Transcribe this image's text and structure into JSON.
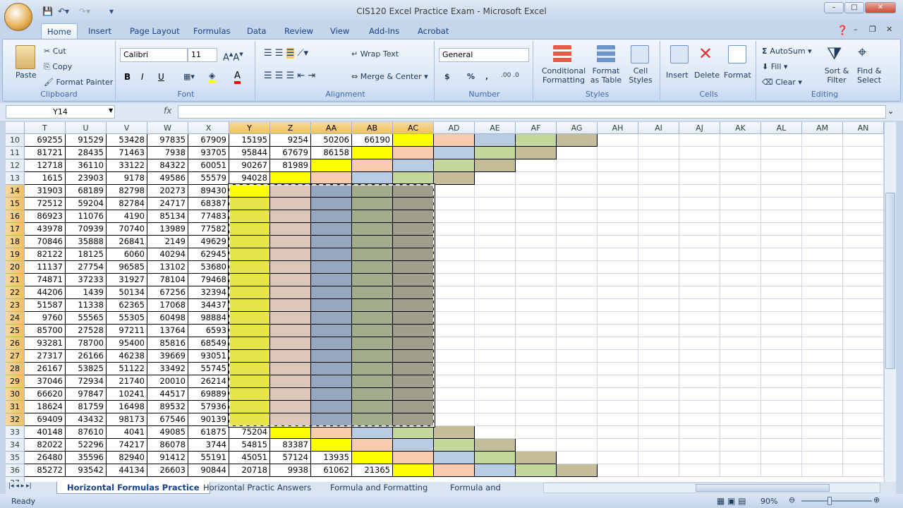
{
  "window": {
    "title": "CIS120 Excel Practice Exam - Microsoft Excel"
  },
  "ribbon_tabs": [
    "Home",
    "Insert",
    "Page Layout",
    "Formulas",
    "Data",
    "Review",
    "View",
    "Add-Ins",
    "Acrobat"
  ],
  "clipboard": {
    "paste": "Paste",
    "cut": "Cut",
    "copy": "Copy",
    "format_painter": "Format Painter",
    "label": "Clipboard"
  },
  "font": {
    "name": "Calibri",
    "size": "11",
    "bold": "B",
    "italic": "I",
    "underline": "U",
    "label": "Font"
  },
  "alignment": {
    "wrap": "Wrap Text",
    "merge": "Merge & Center",
    "label": "Alignment"
  },
  "number": {
    "format": "General",
    "currency": "$",
    "percent": "%",
    "comma": ",",
    "label": "Number"
  },
  "styles": {
    "conditional": "Conditional Formatting",
    "table": "Format as Table",
    "cell": "Cell Styles",
    "label": "Styles"
  },
  "cells": {
    "insert": "Insert",
    "delete": "Delete",
    "format": "Format",
    "label": "Cells"
  },
  "editing": {
    "autosum": "AutoSum",
    "fill": "Fill",
    "clear": "Clear",
    "sort": "Sort & Filter",
    "find": "Find & Select",
    "label": "Editing"
  },
  "formula_bar": {
    "name_box": "Y14",
    "fx": "fx",
    "value": ""
  },
  "columns": [
    "T",
    "U",
    "V",
    "W",
    "X",
    "Y",
    "Z",
    "AA",
    "AB",
    "AC",
    "AD",
    "AE",
    "AF",
    "AG",
    "AH",
    "AI",
    "AJ",
    "AK",
    "AL",
    "AM",
    "AN"
  ],
  "selected_columns": [
    "Y",
    "Z",
    "AA",
    "AB",
    "AC"
  ],
  "fill_colors": [
    "#ffff00",
    "#f8cbad",
    "#b8cce4",
    "#c4d79b",
    "#c4bd97"
  ],
  "selected_fill_colors": [
    "#e6e64a",
    "#dcc6b8",
    "#97a7c0",
    "#a1ad8c",
    "#a09d8c"
  ],
  "rows": [
    {
      "n": 10,
      "vals": [
        69255,
        91529,
        53428,
        97835,
        67909,
        15195,
        9254,
        50206,
        66190
      ],
      "fill": "AC"
    },
    {
      "n": 11,
      "vals": [
        81721,
        28435,
        71463,
        7938,
        93705,
        95844,
        67679,
        86158
      ],
      "fill": "AB"
    },
    {
      "n": 12,
      "vals": [
        12718,
        36110,
        33122,
        84322,
        60051,
        90267,
        81989
      ],
      "fill": "AA"
    },
    {
      "n": 13,
      "vals": [
        1615,
        23903,
        9178,
        49586,
        55579,
        94028
      ],
      "fill": "Z"
    },
    {
      "n": 14,
      "vals": [
        31903,
        68189,
        82798,
        20273,
        89430
      ],
      "fill": "Y",
      "sel": true
    },
    {
      "n": 15,
      "vals": [
        72512,
        59204,
        82784,
        24717,
        68387
      ],
      "fill": "Y",
      "sel": true
    },
    {
      "n": 16,
      "vals": [
        86923,
        11076,
        4190,
        85134,
        77483
      ],
      "fill": "Y",
      "sel": true
    },
    {
      "n": 17,
      "vals": [
        43978,
        70939,
        70740,
        13989,
        77582
      ],
      "fill": "Y",
      "sel": true
    },
    {
      "n": 18,
      "vals": [
        70846,
        35888,
        26841,
        2149,
        49629
      ],
      "fill": "Y",
      "sel": true
    },
    {
      "n": 19,
      "vals": [
        82122,
        18125,
        6060,
        40294,
        62945
      ],
      "fill": "Y",
      "sel": true
    },
    {
      "n": 20,
      "vals": [
        11137,
        27754,
        96585,
        13102,
        53680
      ],
      "fill": "Y",
      "sel": true
    },
    {
      "n": 21,
      "vals": [
        74871,
        37233,
        31927,
        78104,
        79468
      ],
      "fill": "Y",
      "sel": true
    },
    {
      "n": 22,
      "vals": [
        44206,
        1439,
        50134,
        67256,
        32394
      ],
      "fill": "Y",
      "sel": true
    },
    {
      "n": 23,
      "vals": [
        51587,
        11338,
        62365,
        17068,
        34437
      ],
      "fill": "Y",
      "sel": true
    },
    {
      "n": 24,
      "vals": [
        9760,
        55565,
        55305,
        60498,
        98884
      ],
      "fill": "Y",
      "sel": true
    },
    {
      "n": 25,
      "vals": [
        85700,
        27528,
        97211,
        13764,
        6593
      ],
      "fill": "Y",
      "sel": true
    },
    {
      "n": 26,
      "vals": [
        93281,
        78700,
        95400,
        85816,
        68549
      ],
      "fill": "Y",
      "sel": true
    },
    {
      "n": 27,
      "vals": [
        27317,
        26166,
        46238,
        39669,
        93051
      ],
      "fill": "Y",
      "sel": true
    },
    {
      "n": 28,
      "vals": [
        26167,
        53825,
        51122,
        33492,
        55745
      ],
      "fill": "Y",
      "sel": true
    },
    {
      "n": 29,
      "vals": [
        37046,
        72934,
        21740,
        20010,
        26214
      ],
      "fill": "Y",
      "sel": true
    },
    {
      "n": 30,
      "vals": [
        66620,
        97847,
        10241,
        44517,
        69889
      ],
      "fill": "Y",
      "sel": true
    },
    {
      "n": 31,
      "vals": [
        18624,
        81759,
        16498,
        89532,
        57936
      ],
      "fill": "Y",
      "sel": true
    },
    {
      "n": 32,
      "vals": [
        69409,
        43432,
        98173,
        67546,
        90139
      ],
      "fill": "Y",
      "sel": true
    },
    {
      "n": 33,
      "vals": [
        40148,
        87610,
        4041,
        49085,
        61875,
        75204
      ],
      "fill": "Z"
    },
    {
      "n": 34,
      "vals": [
        82022,
        52296,
        74217,
        86078,
        3744,
        54815,
        83387
      ],
      "fill": "AA"
    },
    {
      "n": 35,
      "vals": [
        26480,
        35596,
        82940,
        91412,
        55191,
        45051,
        57124,
        13935
      ],
      "fill": "AB"
    },
    {
      "n": 36,
      "vals": [
        85272,
        93542,
        44134,
        26603,
        90844,
        20718,
        9938,
        61062,
        21365
      ],
      "fill": "AC"
    }
  ],
  "sheet_tabs": [
    "Horizontal Formulas Practice",
    "Horizontal Practic Answers",
    "Formula and Formatting",
    "Formula and Formatti"
  ],
  "status": {
    "ready": "Ready",
    "zoom": "90%"
  }
}
